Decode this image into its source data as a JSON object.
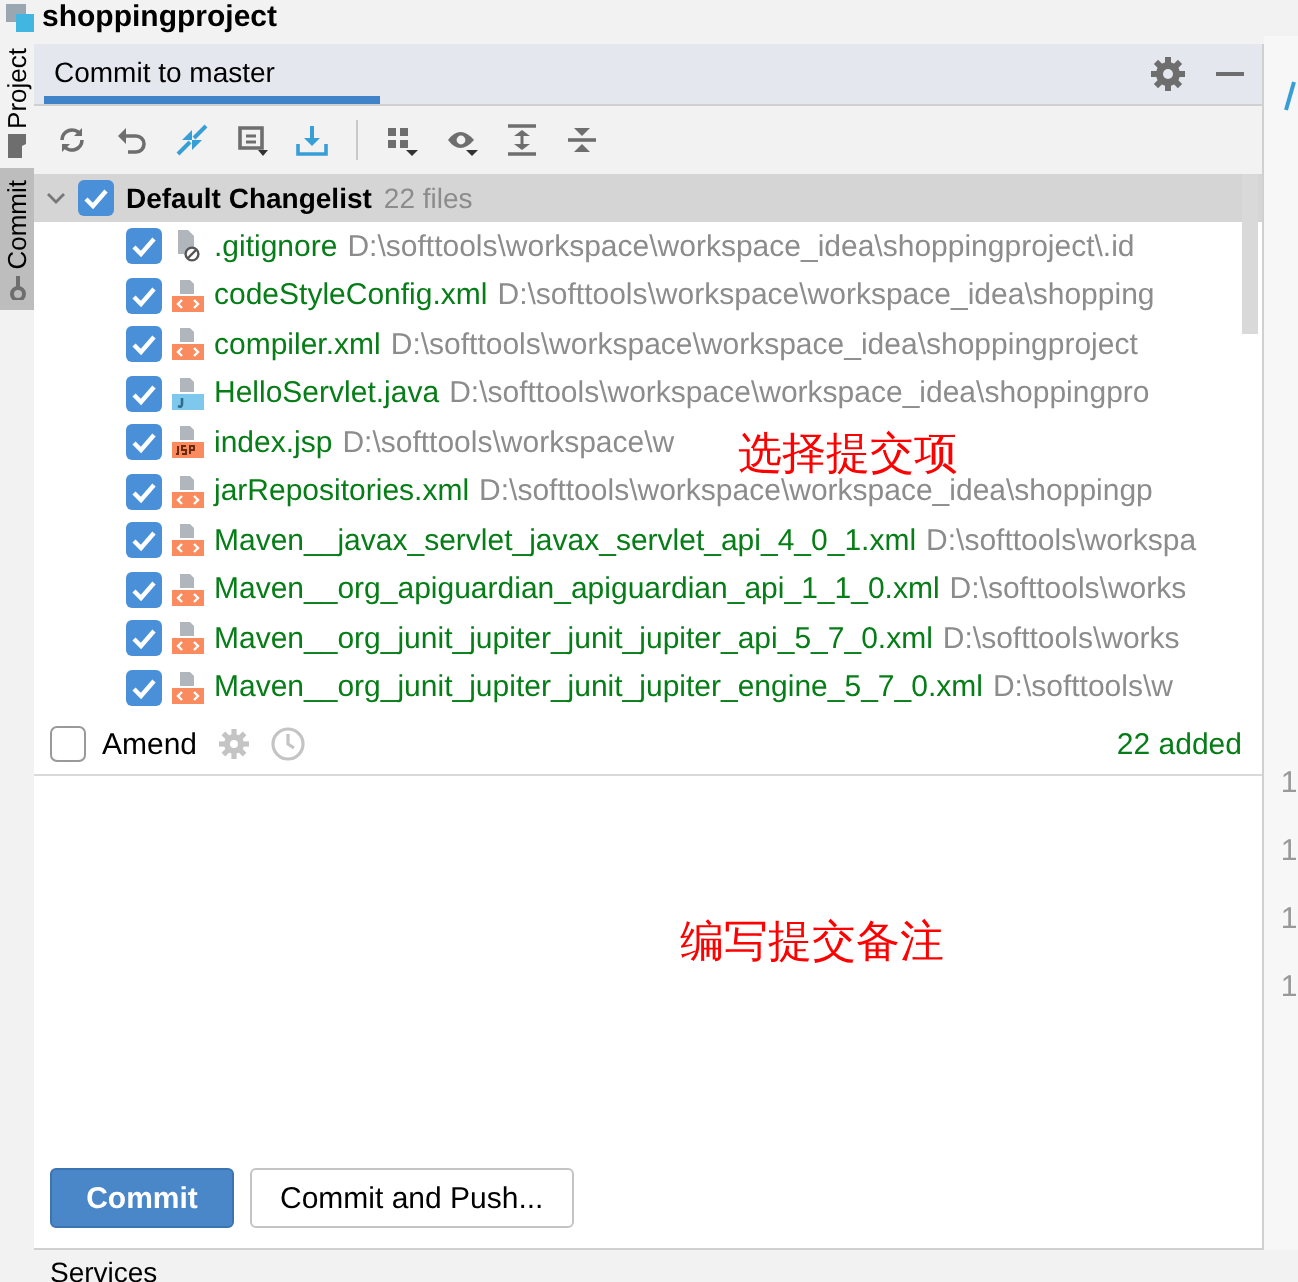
{
  "title_bar": {
    "title": "shoppingproject"
  },
  "side_tabs": [
    {
      "label": "Project",
      "selected": false
    },
    {
      "label": "Commit",
      "selected": true
    }
  ],
  "tabs": [
    {
      "label": "Commit to master",
      "selected": true
    }
  ],
  "changelist": {
    "name": "Default Changelist",
    "count": "22 files",
    "checked": true,
    "expanded": true,
    "files": [
      {
        "name": ".gitignore",
        "path": "D:\\softtools\\workspace\\workspace_idea\\shoppingproject\\.id",
        "kind": "ignored",
        "checked": true
      },
      {
        "name": "codeStyleConfig.xml",
        "path": "D:\\softtools\\workspace\\workspace_idea\\shopping",
        "kind": "xml",
        "checked": true
      },
      {
        "name": "compiler.xml",
        "path": "D:\\softtools\\workspace\\workspace_idea\\shoppingproject",
        "kind": "xml",
        "checked": true
      },
      {
        "name": "HelloServlet.java",
        "path": "D:\\softtools\\workspace\\workspace_idea\\shoppingpro",
        "kind": "java",
        "checked": true
      },
      {
        "name": "index.jsp",
        "path": "D:\\softtools\\workspace\\w",
        "kind": "jsp",
        "checked": true
      },
      {
        "name": "jarRepositories.xml",
        "path": "D:\\softtools\\workspace\\workspace_idea\\shoppingp",
        "kind": "xml",
        "checked": true
      },
      {
        "name": "Maven__javax_servlet_javax_servlet_api_4_0_1.xml",
        "path": "D:\\softtools\\workspa",
        "kind": "xml",
        "checked": true
      },
      {
        "name": "Maven__org_apiguardian_apiguardian_api_1_1_0.xml",
        "path": "D:\\softtools\\works",
        "kind": "xml",
        "checked": true
      },
      {
        "name": "Maven__org_junit_jupiter_junit_jupiter_api_5_7_0.xml",
        "path": "D:\\softtools\\works",
        "kind": "xml",
        "checked": true
      },
      {
        "name": "Maven__org_junit_jupiter_junit_jupiter_engine_5_7_0.xml",
        "path": "D:\\softtools\\w",
        "kind": "xml",
        "checked": true
      }
    ]
  },
  "amend": {
    "label": "Amend",
    "checked": false
  },
  "summary": "22 added",
  "list_annotation": "选择提交项",
  "message_annotation": "编写提交备注",
  "buttons": [
    {
      "label": "Commit",
      "kind": "primary"
    },
    {
      "label": "Commit and Push...",
      "kind": "secondary"
    }
  ],
  "gutter": [
    "1",
    "1",
    "1",
    "1"
  ],
  "bottom_tab": "Services"
}
